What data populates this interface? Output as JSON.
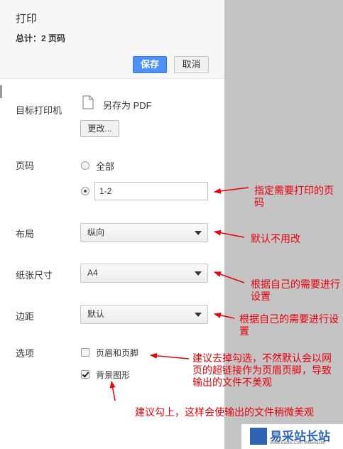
{
  "header": {
    "title": "打印",
    "summary": "总计：2 页码",
    "save_label": "保存",
    "cancel_label": "取消"
  },
  "destination": {
    "label": "目标打印机",
    "value": "另存为 PDF",
    "change_label": "更改..."
  },
  "pages": {
    "label": "页码",
    "option_all": "全部",
    "range_value": "1-2",
    "selected": "range"
  },
  "layout": {
    "label": "布局",
    "value": "纵向"
  },
  "paper": {
    "label": "纸张尺寸",
    "value": "A4"
  },
  "margins": {
    "label": "边距",
    "value": "默认"
  },
  "options": {
    "label": "选项",
    "headers_footers": {
      "label": "页眉和页脚",
      "checked": false
    },
    "background_graphics": {
      "label": "背景图形",
      "checked": true
    }
  },
  "annotations": {
    "pages_note": "指定需要打印的页码",
    "layout_note": "默认不用改",
    "paper_note": "根据自己的需要进行设置",
    "margins_note": "根据自己的需要进行设置",
    "headers_note": "建议去掉勾选，不然默认会以网页的超链接作为页眉页脚，导致输出的文件不美观",
    "background_note": "建议勾上，这样会使输出的文件稍微美观"
  },
  "watermark": {
    "text": "易采站长站",
    "sub": "Www.Easck.Com Webmaster"
  },
  "colors": {
    "accent": "#4d90fe",
    "annotation": "#e8000b",
    "sidebar_bg": "#c4c4c4"
  }
}
